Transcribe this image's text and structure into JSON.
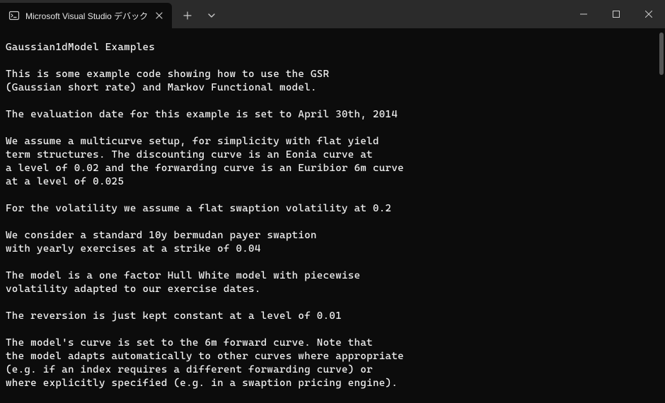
{
  "window": {
    "tab_title": "Microsoft Visual Studio デバック"
  },
  "terminal": {
    "lines": [
      "Gaussian1dModel Examples",
      "",
      "This is some example code showing how to use the GSR",
      "(Gaussian short rate) and Markov Functional model.",
      "",
      "The evaluation date for this example is set to April 30th, 2014",
      "",
      "We assume a multicurve setup, for simplicity with flat yield",
      "term structures. The discounting curve is an Eonia curve at",
      "a level of 0.02 and the forwarding curve is an Euribior 6m curve",
      "at a level of 0.025",
      "",
      "For the volatility we assume a flat swaption volatility at 0.2",
      "",
      "We consider a standard 10y bermudan payer swaption",
      "with yearly exercises at a strike of 0.04",
      "",
      "The model is a one factor Hull White model with piecewise",
      "volatility adapted to our exercise dates.",
      "",
      "The reversion is just kept constant at a level of 0.01",
      "",
      "The model's curve is set to the 6m forward curve. Note that",
      "the model adapts automatically to other curves where appropriate",
      "(e.g. if an index requires a different forwarding curve) or",
      "where explicitly specified (e.g. in a swaption pricing engine)."
    ]
  }
}
